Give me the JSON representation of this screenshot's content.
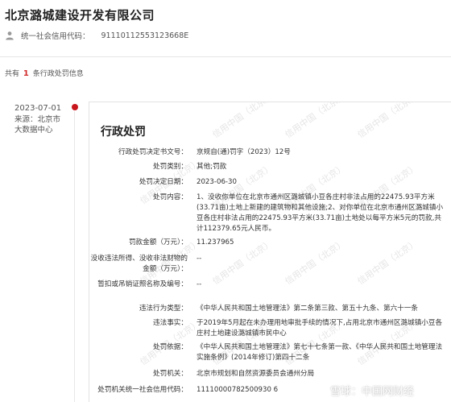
{
  "header": {
    "company_name": "北京潞城建设开发有限公司",
    "credit_label": "统一社会信用代码：",
    "credit_code": "91110112553123668E"
  },
  "summary": {
    "prefix": "共有",
    "count": "1",
    "suffix": "条行政处罚信息"
  },
  "timeline": {
    "date": "2023-07-01",
    "source_label": "来源：",
    "source_value": "北京市",
    "source_value_2": "大数据中心"
  },
  "card": {
    "title": "行政处罚",
    "watermark_text": "信用中国（北京）",
    "rows": [
      {
        "label": "行政处罚决定书文号：",
        "value": "京规自(通)罚字（2023）12号"
      },
      {
        "label": "处罚类别：",
        "value": "其他;罚款"
      },
      {
        "label": "处罚决定日期：",
        "value": "2023-06-30"
      },
      {
        "label": "处罚内容：",
        "value": "1、没收你单位在北京市通州区潞城镇小豆各庄村非法占用的22475.93平方米(33.71亩)土地上新建的建筑物和其他设施;2、对你单位在北京市通州区潞城镇小豆各庄村非法占用的22475.93平方米(33.71亩)土地处以每平方米5元的罚款,共计112379.65元人民币。"
      },
      {
        "label": "罚款金额（万元）：",
        "value": "11.237965"
      },
      {
        "label": "没收违法所得、没收非法财物的金额（万元）：",
        "value": "--"
      },
      {
        "label": "暂扣或吊销证照名称及编号：",
        "value": "--"
      },
      {
        "label": "违法行为类型：",
        "value": "《中华人民共和国土地管理法》第二条第三款、第五十九条、第六十一条"
      },
      {
        "label": "违法事实：",
        "value": "于2019年5月起在未办理用地审批手续的情况下,占用北京市通州区潞城镇小豆各庄村土地建设潞城镇市民中心"
      },
      {
        "label": "处罚依据：",
        "value": "《中华人民共和国土地管理法》第七十七条第一款、《中华人民共和国土地管理法实施条例》(2014年修订)第四十二条"
      },
      {
        "label": "处罚机关：",
        "value": "北京市规划和自然资源委员会通州分局"
      },
      {
        "label": "处罚机关统一社会信用代码：",
        "value": "11110000782500930 6"
      }
    ]
  },
  "footer": {
    "brand_text": "雪球：中国网财经"
  },
  "colors": {
    "accent_red": "#c8161d",
    "count_red": "#d12c2c"
  }
}
